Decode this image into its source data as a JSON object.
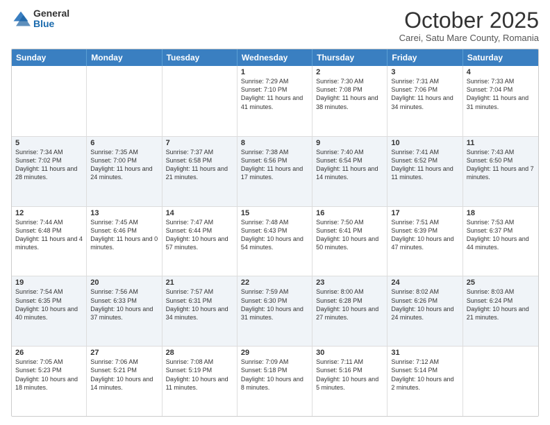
{
  "header": {
    "logo_general": "General",
    "logo_blue": "Blue",
    "month_title": "October 2025",
    "location": "Carei, Satu Mare County, Romania"
  },
  "days_of_week": [
    "Sunday",
    "Monday",
    "Tuesday",
    "Wednesday",
    "Thursday",
    "Friday",
    "Saturday"
  ],
  "rows": [
    {
      "alt": false,
      "cells": [
        {
          "day": "",
          "text": ""
        },
        {
          "day": "",
          "text": ""
        },
        {
          "day": "",
          "text": ""
        },
        {
          "day": "1",
          "text": "Sunrise: 7:29 AM\nSunset: 7:10 PM\nDaylight: 11 hours and 41 minutes."
        },
        {
          "day": "2",
          "text": "Sunrise: 7:30 AM\nSunset: 7:08 PM\nDaylight: 11 hours and 38 minutes."
        },
        {
          "day": "3",
          "text": "Sunrise: 7:31 AM\nSunset: 7:06 PM\nDaylight: 11 hours and 34 minutes."
        },
        {
          "day": "4",
          "text": "Sunrise: 7:33 AM\nSunset: 7:04 PM\nDaylight: 11 hours and 31 minutes."
        }
      ]
    },
    {
      "alt": true,
      "cells": [
        {
          "day": "5",
          "text": "Sunrise: 7:34 AM\nSunset: 7:02 PM\nDaylight: 11 hours and 28 minutes."
        },
        {
          "day": "6",
          "text": "Sunrise: 7:35 AM\nSunset: 7:00 PM\nDaylight: 11 hours and 24 minutes."
        },
        {
          "day": "7",
          "text": "Sunrise: 7:37 AM\nSunset: 6:58 PM\nDaylight: 11 hours and 21 minutes."
        },
        {
          "day": "8",
          "text": "Sunrise: 7:38 AM\nSunset: 6:56 PM\nDaylight: 11 hours and 17 minutes."
        },
        {
          "day": "9",
          "text": "Sunrise: 7:40 AM\nSunset: 6:54 PM\nDaylight: 11 hours and 14 minutes."
        },
        {
          "day": "10",
          "text": "Sunrise: 7:41 AM\nSunset: 6:52 PM\nDaylight: 11 hours and 11 minutes."
        },
        {
          "day": "11",
          "text": "Sunrise: 7:43 AM\nSunset: 6:50 PM\nDaylight: 11 hours and 7 minutes."
        }
      ]
    },
    {
      "alt": false,
      "cells": [
        {
          "day": "12",
          "text": "Sunrise: 7:44 AM\nSunset: 6:48 PM\nDaylight: 11 hours and 4 minutes."
        },
        {
          "day": "13",
          "text": "Sunrise: 7:45 AM\nSunset: 6:46 PM\nDaylight: 11 hours and 0 minutes."
        },
        {
          "day": "14",
          "text": "Sunrise: 7:47 AM\nSunset: 6:44 PM\nDaylight: 10 hours and 57 minutes."
        },
        {
          "day": "15",
          "text": "Sunrise: 7:48 AM\nSunset: 6:43 PM\nDaylight: 10 hours and 54 minutes."
        },
        {
          "day": "16",
          "text": "Sunrise: 7:50 AM\nSunset: 6:41 PM\nDaylight: 10 hours and 50 minutes."
        },
        {
          "day": "17",
          "text": "Sunrise: 7:51 AM\nSunset: 6:39 PM\nDaylight: 10 hours and 47 minutes."
        },
        {
          "day": "18",
          "text": "Sunrise: 7:53 AM\nSunset: 6:37 PM\nDaylight: 10 hours and 44 minutes."
        }
      ]
    },
    {
      "alt": true,
      "cells": [
        {
          "day": "19",
          "text": "Sunrise: 7:54 AM\nSunset: 6:35 PM\nDaylight: 10 hours and 40 minutes."
        },
        {
          "day": "20",
          "text": "Sunrise: 7:56 AM\nSunset: 6:33 PM\nDaylight: 10 hours and 37 minutes."
        },
        {
          "day": "21",
          "text": "Sunrise: 7:57 AM\nSunset: 6:31 PM\nDaylight: 10 hours and 34 minutes."
        },
        {
          "day": "22",
          "text": "Sunrise: 7:59 AM\nSunset: 6:30 PM\nDaylight: 10 hours and 31 minutes."
        },
        {
          "day": "23",
          "text": "Sunrise: 8:00 AM\nSunset: 6:28 PM\nDaylight: 10 hours and 27 minutes."
        },
        {
          "day": "24",
          "text": "Sunrise: 8:02 AM\nSunset: 6:26 PM\nDaylight: 10 hours and 24 minutes."
        },
        {
          "day": "25",
          "text": "Sunrise: 8:03 AM\nSunset: 6:24 PM\nDaylight: 10 hours and 21 minutes."
        }
      ]
    },
    {
      "alt": false,
      "cells": [
        {
          "day": "26",
          "text": "Sunrise: 7:05 AM\nSunset: 5:23 PM\nDaylight: 10 hours and 18 minutes."
        },
        {
          "day": "27",
          "text": "Sunrise: 7:06 AM\nSunset: 5:21 PM\nDaylight: 10 hours and 14 minutes."
        },
        {
          "day": "28",
          "text": "Sunrise: 7:08 AM\nSunset: 5:19 PM\nDaylight: 10 hours and 11 minutes."
        },
        {
          "day": "29",
          "text": "Sunrise: 7:09 AM\nSunset: 5:18 PM\nDaylight: 10 hours and 8 minutes."
        },
        {
          "day": "30",
          "text": "Sunrise: 7:11 AM\nSunset: 5:16 PM\nDaylight: 10 hours and 5 minutes."
        },
        {
          "day": "31",
          "text": "Sunrise: 7:12 AM\nSunset: 5:14 PM\nDaylight: 10 hours and 2 minutes."
        },
        {
          "day": "",
          "text": ""
        }
      ]
    }
  ]
}
